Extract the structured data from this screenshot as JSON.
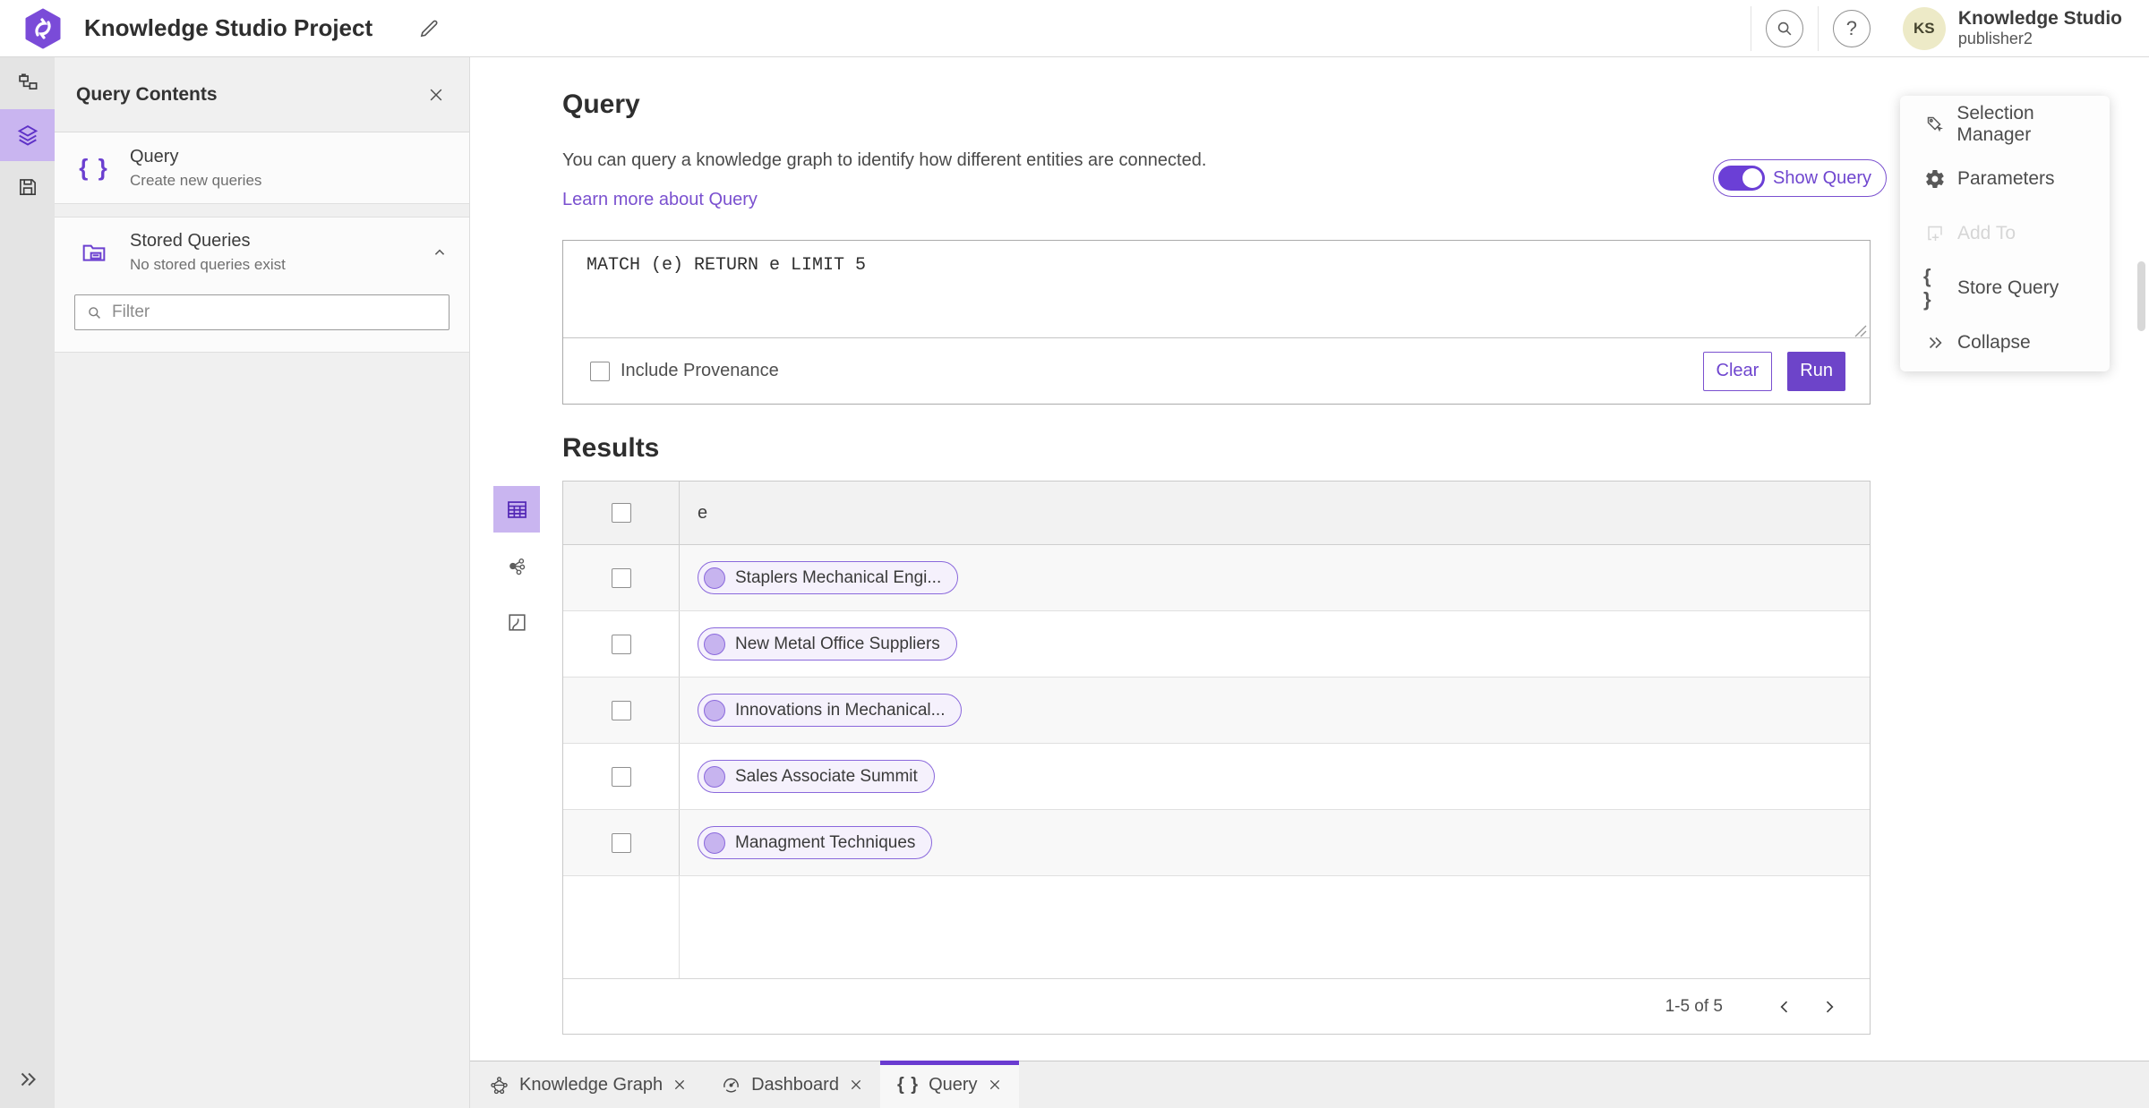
{
  "colors": {
    "accent": "#6d44c9",
    "accent_border": "#7a50cf",
    "accent_icon": "#5e31c7",
    "accent_light_bg": "#c9b5f0",
    "pill_bg": "#f5f1fc",
    "pill_border": "#8a68dc",
    "avatar_bg": "#edeac7",
    "active_tab_indicator": "#6a3bd0"
  },
  "icons": {
    "braces": "{ }",
    "question": "?"
  },
  "header": {
    "title": "Knowledge Studio Project",
    "user": {
      "initials": "KS",
      "name": "Knowledge Studio",
      "role": "publisher2"
    }
  },
  "contents_panel": {
    "title": "Query Contents",
    "query_item": {
      "title": "Query",
      "subtitle": "Create new queries"
    },
    "stored_item": {
      "title": "Stored Queries",
      "subtitle": "No stored queries exist"
    },
    "filter_placeholder": "Filter"
  },
  "query_section": {
    "heading": "Query",
    "description": "You can query a knowledge graph to identify how different entities are connected.",
    "learn_more_label": "Learn more about Query",
    "show_query_label": "Show Query",
    "query_text": "MATCH (e) RETURN e LIMIT 5",
    "include_provenance_label": "Include Provenance",
    "clear_label": "Clear",
    "run_label": "Run"
  },
  "results": {
    "heading": "Results",
    "column_header": "e",
    "rows": [
      "Staplers Mechanical Engi...",
      "New Metal Office Suppliers",
      "Innovations in Mechanical...",
      "Sales Associate Summit",
      "Managment Techniques"
    ],
    "pagination_label": "1-5 of 5"
  },
  "context_menu": {
    "items": [
      {
        "label": "Selection Manager",
        "disabled": false
      },
      {
        "label": "Parameters",
        "disabled": false
      },
      {
        "label": "Add To",
        "disabled": true
      },
      {
        "label": "Store Query",
        "disabled": false
      },
      {
        "label": "Collapse",
        "disabled": false
      }
    ]
  },
  "tabs": [
    {
      "label": "Knowledge Graph",
      "active": false
    },
    {
      "label": "Dashboard",
      "active": false
    },
    {
      "label": "Query",
      "active": true
    }
  ]
}
